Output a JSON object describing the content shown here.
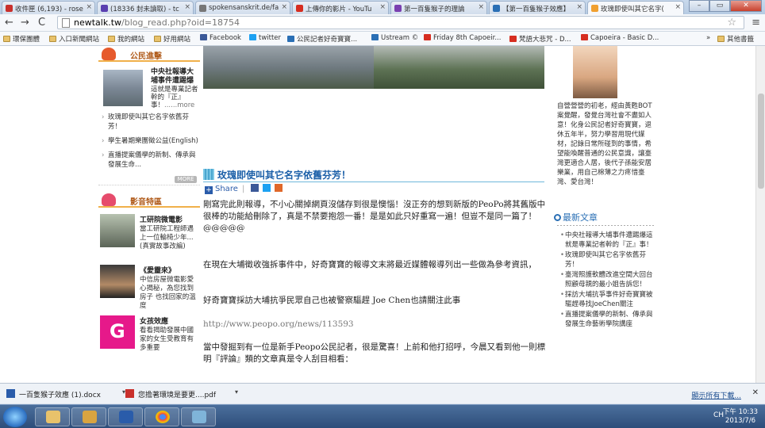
{
  "tabs": [
    {
      "label": "收件匣 (6,193) - rose",
      "color": "#c9302c"
    },
    {
      "label": "(18336 封未讀取) - tc",
      "color": "#5a3fb0"
    },
    {
      "label": "spokensanskrit.de/fa",
      "color": "#444444"
    },
    {
      "label": "上傳你的影片 - YouTu",
      "color": "#d62d20"
    },
    {
      "label": "第一百隻猴子的理論",
      "color": "#7a3fb0"
    },
    {
      "label": "【第一百隻猴子效應】",
      "color": "#2a6fb5"
    },
    {
      "label": "玫瑰即使叫其它名字(",
      "color": "#f0a030"
    }
  ],
  "window": {
    "minimize": "–",
    "maximize": "▭",
    "close": "✕"
  },
  "nav": {
    "back": "←",
    "forward": "→",
    "reload": "C"
  },
  "url": {
    "host": "newtalk.tw",
    "path": "/blog_read.php?oid=18754"
  },
  "bookmarks": [
    {
      "label": "環保團體",
      "icon": "folder"
    },
    {
      "label": "入口新聞網站",
      "icon": "folder"
    },
    {
      "label": "我的網站",
      "icon": "folder"
    },
    {
      "label": "好用網站",
      "icon": "folder"
    },
    {
      "label": "Facebook",
      "icon": "facebook"
    },
    {
      "label": "twitter",
      "icon": "twitter"
    },
    {
      "label": "公民記者好奇寶寶...",
      "icon": "ustream"
    },
    {
      "label": "Ustream ©",
      "icon": "ustream"
    },
    {
      "label": "Friday 8th Capoeir...",
      "icon": "youtube"
    },
    {
      "label": "梵語大悲咒 - D...",
      "icon": "youtube"
    },
    {
      "label": "Capoeira - Basic D...",
      "icon": "youtube"
    },
    {
      "label": "»",
      "icon": "none"
    },
    {
      "label": "其他書籤",
      "icon": "folder"
    }
  ],
  "left": {
    "section1": "公民進擊",
    "feature": {
      "title": "中央社報導大埔事件遭踢爆",
      "desc": "這就是專業記者幹的『正』事！",
      "more": "......more"
    },
    "list": [
      "玫瑰即使叫其它名字依舊芬芳！",
      "學生暑期樂團徵公益(English)",
      "直播提案儀學的新制、傳承與發展生命..."
    ],
    "more_badge": "MORE",
    "section2": "影音特區",
    "media": [
      {
        "title": "工研院微電影",
        "desc": "當工研院工程師遇上一位輪椅少年...(真實故事改編)"
      },
      {
        "title": "《愛靈來》",
        "desc": "中信房屋微電影愛心揭秘，為您找到房子 也找回家的溫度"
      },
      {
        "title": "女孩效應",
        "desc": "看看揭助發展中國家的女生受教育有多重要"
      }
    ]
  },
  "article": {
    "title": "玫瑰即使叫其它名字依舊芬芳！",
    "share": "Share",
    "p1": "剛寫完此則報導，不小心關掉網頁沒儲存到很是懊惱！沒正夯的想到新版的PeoPo將其舊版中很棒的功能給刪除了，真是不禁要抱怨一番！是是如此只好重寫一遍！但豈不是同一篇了！",
    "p1b": "@@@@@",
    "p2": "在現在大埔徵收強拆事件中，好奇寶寶的報導文末將最近媒體報導列出一些做為參考資訊，",
    "p3": "好奇寶寶採訪大埔抗爭民眾自己也被警察驅趕 Joe Chen也請關注此事",
    "link": "http://www.peopo.org/news/113593",
    "p4": "當中發掘到有一位是新手Peopo公民記者，很是驚喜！上前和他打招呼，今晨又看到他一則標明『評論』類的文章真是令人刮目相看："
  },
  "right": {
    "bio": "自營營營的初老，經由黃甦BOT案覺醒，發覺台灣社會不盡如人意！化身公民記者好奇寶寶，退休五年半，努力學習用現代媒材，記錄日常所碰到的事情，希望能喚醒普通的公民意識，讓臺灣更適合人居，後代子孫能安居樂業，用自己棉薄之力疼惜臺灣、愛台灣！",
    "latest_head": "最新文章",
    "latest": [
      "中央社報導大埔事件遭踢爆這就是專業記者幹的『正』事！",
      "玫瑰即使叫其它名字依舊芬芳！",
      "臺灣照護軟體改進空間大回台照顧母親的最小姐告訴您！",
      "採訪大埔抗爭事件好奇寶寶被驅趕尋找JoeChen關注",
      "直播提案儀學的新制、傳承與發展生命藝術學院講座"
    ]
  },
  "downloads": [
    {
      "label": "一百隻猴子效應 (1).docx",
      "color": "#2a5caa"
    },
    {
      "label": "您擔著環境是要更....pdf",
      "color": "#c9302c"
    }
  ],
  "shelf": {
    "show_all": "顯示所有下載...",
    "close": "✕"
  },
  "taskbar": {
    "tray": "CH",
    "time": "下午 10:33",
    "date": "2013/7/6"
  }
}
